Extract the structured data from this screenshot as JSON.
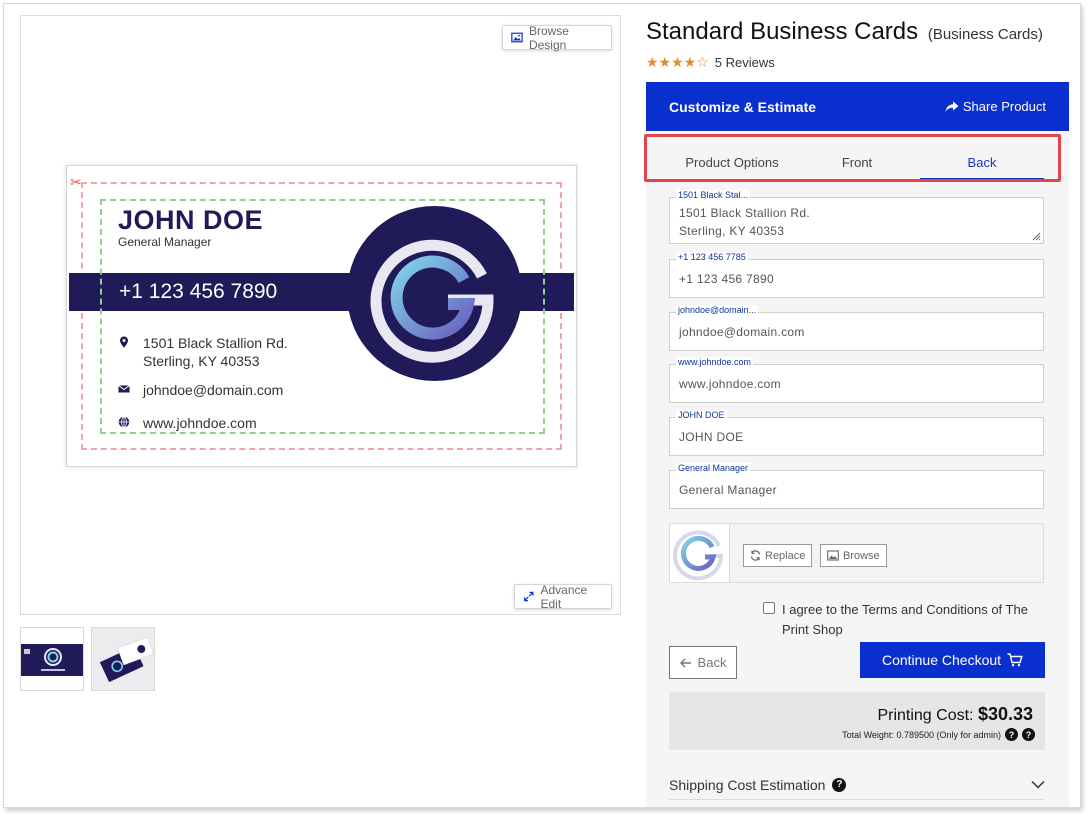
{
  "preview": {
    "browse_design_label": "Browse Design",
    "advance_edit_label": "Advance Edit",
    "card": {
      "name": "JOHN DOE",
      "title": "General Manager",
      "phone": "+1 123 456 7890",
      "address_line1": "1501 Black Stallion Rd.",
      "address_line2": "Sterling, KY 40353",
      "email": "johndoe@domain.com",
      "website": "www.johndoe.com",
      "brand_color": "#211a58"
    }
  },
  "product": {
    "title": "Standard Business Cards",
    "category": "(Business Cards)",
    "rating_stars": "★★★★☆",
    "rating": 4,
    "rating_max": 5,
    "reviews_label": "5 Reviews"
  },
  "header": {
    "title": "Customize & Estimate",
    "share_label": "Share Product",
    "accent": "#0a2fcf"
  },
  "tabs": [
    {
      "label": "Product Options",
      "active": false
    },
    {
      "label": "Front",
      "active": false
    },
    {
      "label": "Back",
      "active": true
    }
  ],
  "fields": {
    "address": {
      "label": "1501 Black Stal...",
      "line1": "1501 Black Stallion Rd.",
      "line2": "Sterling, KY 40353"
    },
    "phone": {
      "label": "+1 123 456 7785",
      "value": "+1 123 456 7890"
    },
    "email": {
      "label": "johndoe@domain...",
      "value": "johndoe@domain.com"
    },
    "website": {
      "label": "www.johndoe.com",
      "value": "www.johndoe.com"
    },
    "name": {
      "label": "JOHN DOE",
      "value": "JOHN DOE"
    },
    "title": {
      "label": "General Manager",
      "value": "General Manager"
    }
  },
  "image_field": {
    "replace_label": "Replace",
    "browse_label": "Browse"
  },
  "agree": {
    "text": "I agree to the Terms and Conditions of The Print Shop",
    "checked": false
  },
  "actions": {
    "back_label": "Back",
    "checkout_label": "Continue Checkout"
  },
  "cost": {
    "label": "Printing Cost:",
    "value": "$30.33",
    "weight_text": "Total Weight: 0.789500 (Only for admin)"
  },
  "shipping": {
    "label": "Shipping Cost Estimation"
  }
}
